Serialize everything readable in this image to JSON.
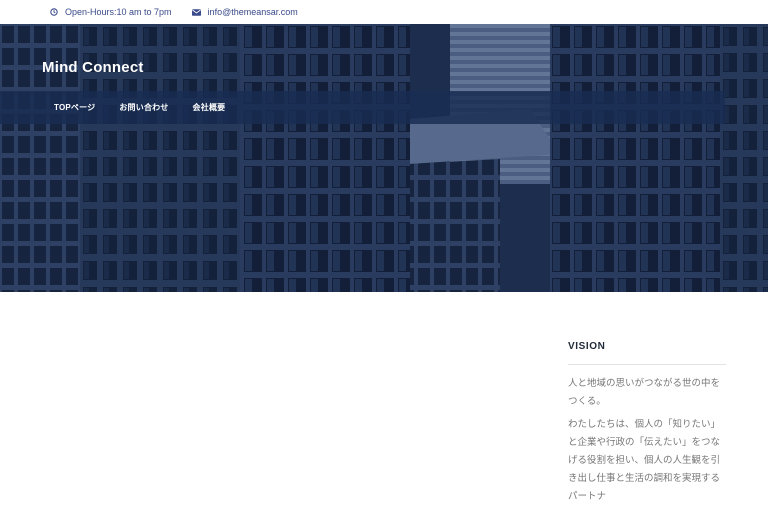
{
  "topbar": {
    "hours": "Open-Hours:10 am to 7pm",
    "email": "info@themeansar.com",
    "hours_icon": "clock-icon",
    "email_icon": "envelope-icon"
  },
  "header": {
    "site_title": "Mind Connect"
  },
  "nav": {
    "items": [
      {
        "label": "TOPページ"
      },
      {
        "label": "お問い合わせ"
      },
      {
        "label": "会社概要"
      }
    ]
  },
  "sidebar": {
    "widget_title": "VISION",
    "paragraph1": "人と地域の思いがつながる世の中をつくる。",
    "paragraph2": "わたしたちは、個人の「知りたい」と企業や行政の「伝えたい」をつなげる役割を担い、個人の人生観を引き出し仕事と生活の調和を実現するパートナ"
  },
  "colors": {
    "accent": "#3a4a8a",
    "hero_overlay": "#1f3150",
    "nav_bar": "#182c52"
  }
}
